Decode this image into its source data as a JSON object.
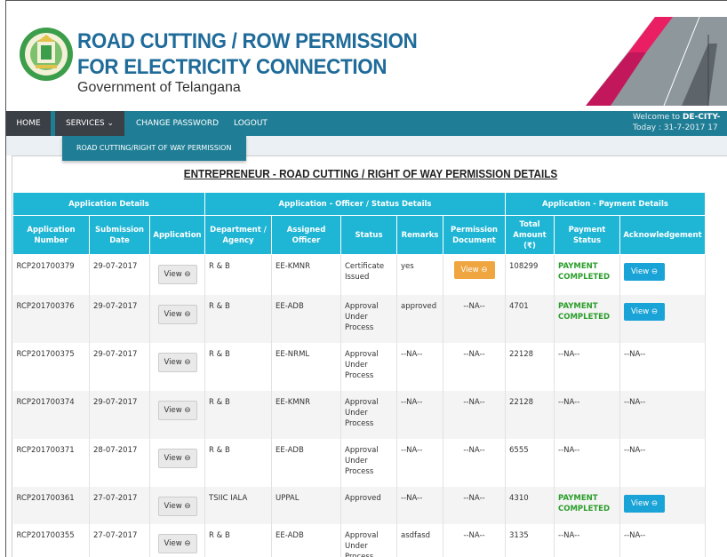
{
  "header": {
    "title_line1": "ROAD CUTTING / ROW PERMISSION",
    "title_line2": "FOR ELECTRICITY CONNECTION",
    "subtitle": "Government of Telangana"
  },
  "nav": {
    "home": "HOME",
    "services": "SERVICES ⌄",
    "change_password": "CHANGE PASSWORD",
    "logout": "LOGOUT",
    "welcome_prefix": "Welcome to ",
    "welcome_user": "DE-CITY-",
    "today": "Today : 31-7-2017 17"
  },
  "dropdown": {
    "item": "ROAD CUTTING/RIGHT OF WAY PERMISSION"
  },
  "page_heading": "ENTREPRENEUR - ROAD CUTTING / RIGHT OF WAY PERMISSION DETAILS",
  "table": {
    "groups": [
      "Application Details",
      "Application - Officer / Status Details",
      "Application - Payment Details"
    ],
    "columns": [
      "Application Number",
      "Submission Date",
      "Application",
      "Department / Agency",
      "Assigned Officer",
      "Status",
      "Remarks",
      "Permission Document",
      "Total Amount (₹)",
      "Payment Status",
      "Acknowledgement"
    ],
    "rows": [
      {
        "number": "RCP201700379",
        "date": "29-07-2017",
        "app": "View ⊖",
        "dept": "R & B",
        "officer": "EE-KMNR",
        "status": "Certificate Issued",
        "remarks": "yes",
        "doc": "View ⊖",
        "amount": "108299",
        "payment": "PAYMENT COMPLETED",
        "ack": "View ⊖"
      },
      {
        "number": "RCP201700376",
        "date": "29-07-2017",
        "app": "View ⊖",
        "dept": "R & B",
        "officer": "EE-ADB",
        "status": "Approval Under Process",
        "remarks": "approved",
        "doc": "--NA--",
        "amount": "4701",
        "payment": "PAYMENT COMPLETED",
        "ack": "View ⊖"
      },
      {
        "number": "RCP201700375",
        "date": "29-07-2017",
        "app": "View ⊖",
        "dept": "R & B",
        "officer": "EE-NRML",
        "status": "Approval Under Process",
        "remarks": "--NA--",
        "doc": "--NA--",
        "amount": "22128",
        "payment": "--NA--",
        "ack": "--NA--"
      },
      {
        "number": "RCP201700374",
        "date": "29-07-2017",
        "app": "View ⊖",
        "dept": "R & B",
        "officer": "EE-KMNR",
        "status": "Approval Under Process",
        "remarks": "--NA--",
        "doc": "--NA--",
        "amount": "22128",
        "payment": "--NA--",
        "ack": "--NA--"
      },
      {
        "number": "RCP201700371",
        "date": "28-07-2017",
        "app": "View ⊖",
        "dept": "R & B",
        "officer": "EE-ADB",
        "status": "Approval Under Process",
        "remarks": "--NA--",
        "doc": "--NA--",
        "amount": "6555",
        "payment": "--NA--",
        "ack": "--NA--"
      },
      {
        "number": "RCP201700361",
        "date": "27-07-2017",
        "app": "View ⊖",
        "dept": "TSIIC IALA",
        "officer": "UPPAL",
        "status": "Approved",
        "remarks": "--NA--",
        "doc": "--NA--",
        "amount": "4310",
        "payment": "PAYMENT COMPLETED",
        "ack": "View ⊖"
      },
      {
        "number": "RCP201700355",
        "date": "27-07-2017",
        "app": "View ⊖",
        "dept": "R & B",
        "officer": "EE-ADB",
        "status": "Approval Under Process",
        "remarks": "asdfasd",
        "doc": "--NA--",
        "amount": "3135",
        "payment": "--NA--",
        "ack": "--NA--"
      }
    ]
  },
  "colors": {
    "title_blue": "#1f6b99",
    "navbar_teal": "#1f7e96",
    "header_cyan": "#1fb5d4",
    "payment_green": "#2a9d2a",
    "orange_button": "#f0a640",
    "blue_button": "#1aa3d6"
  }
}
